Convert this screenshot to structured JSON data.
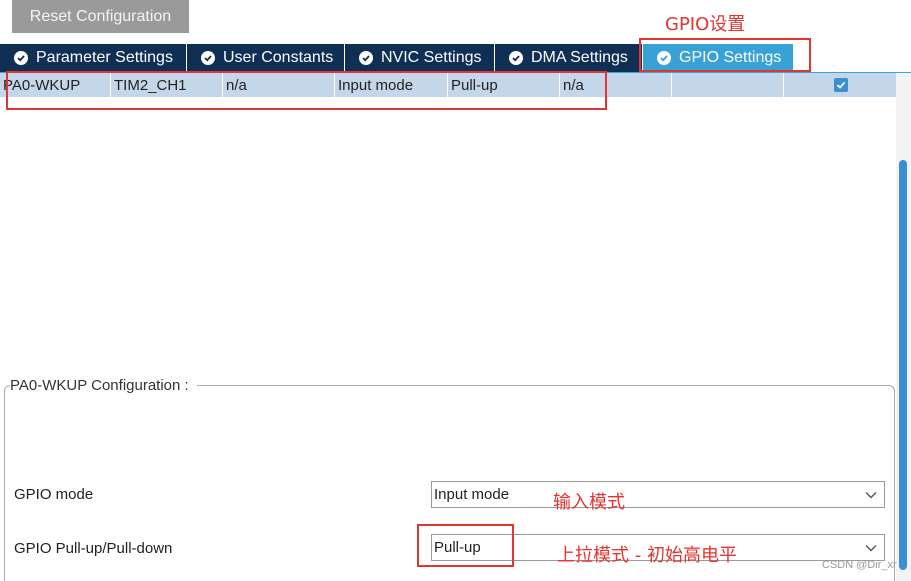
{
  "toolbar": {
    "reset_label": "Reset Configuration"
  },
  "annotations": {
    "title": "GPIO设置",
    "gpio_mode_note": "输入模式",
    "pull_note": "上拉模式 - 初始高电平"
  },
  "tabs": [
    {
      "label": "Parameter Settings",
      "active": false
    },
    {
      "label": "User Constants",
      "active": false
    },
    {
      "label": "NVIC Settings",
      "active": false
    },
    {
      "label": "DMA Settings",
      "active": false
    },
    {
      "label": "GPIO Settings",
      "active": true
    }
  ],
  "table": {
    "selected_row": [
      "PA0-WKUP",
      "TIM2_CH1",
      "n/a",
      "Input mode",
      "Pull-up",
      "n/a",
      "",
      "",
      ""
    ],
    "selected_row_checked": true
  },
  "config": {
    "legend": "PA0-WKUP Configuration :",
    "fields": [
      {
        "label": "GPIO mode",
        "value": "Input mode"
      },
      {
        "label": "GPIO Pull-up/Pull-down",
        "value": "Pull-up"
      }
    ]
  },
  "watermark": "CSDN @Dir_xr",
  "colors": {
    "tab_bg": "#0f2f55",
    "tab_active": "#38a1d6",
    "row_selected": "#c4d7ea",
    "annotation": "#e3342f"
  }
}
